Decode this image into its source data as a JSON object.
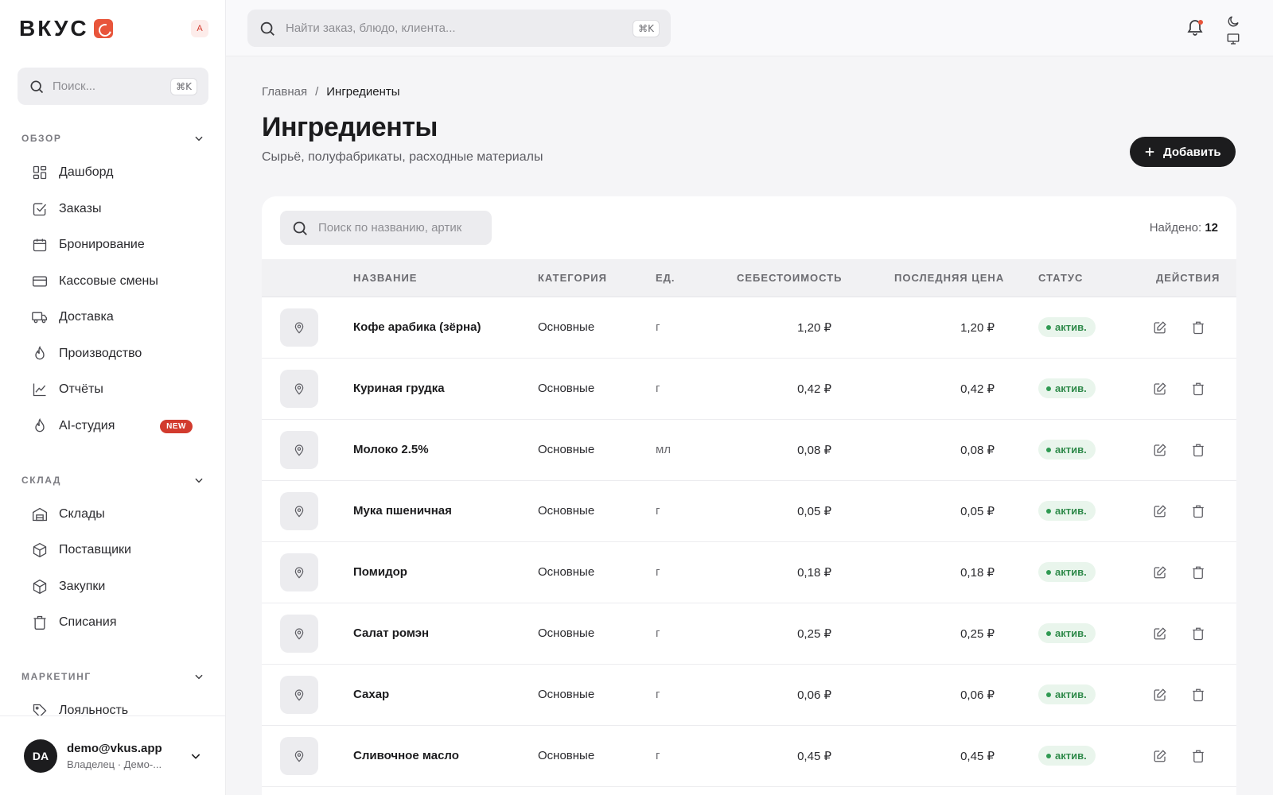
{
  "app": {
    "logo": "ВКУС",
    "avatar_letter": "A",
    "brand_color": "#e8553b"
  },
  "sidebar": {
    "search": {
      "placeholder": "Поиск...",
      "shortcut": "⌘K"
    },
    "sections": [
      {
        "label": "ОБЗОР",
        "items": [
          {
            "label": "Дашборд",
            "icon": "dashboard-icon"
          },
          {
            "label": "Заказы",
            "icon": "checkbox-icon"
          },
          {
            "label": "Бронирование",
            "icon": "calendar-icon"
          },
          {
            "label": "Кассовые смены",
            "icon": "credit-card-icon"
          },
          {
            "label": "Доставка",
            "icon": "truck-icon"
          },
          {
            "label": "Производство",
            "icon": "flame-icon"
          },
          {
            "label": "Отчёты",
            "icon": "chart-line-icon"
          },
          {
            "label": "AI-студия",
            "icon": "flame-icon",
            "badge": "NEW"
          }
        ]
      },
      {
        "label": "СКЛАД",
        "items": [
          {
            "label": "Склады",
            "icon": "warehouse-icon"
          },
          {
            "label": "Поставщики",
            "icon": "box-icon"
          },
          {
            "label": "Закупки",
            "icon": "box-icon"
          },
          {
            "label": "Списания",
            "icon": "trash-icon"
          }
        ]
      },
      {
        "label": "МАРКЕТИНГ",
        "items": [
          {
            "label": "Лояльность",
            "icon": "tag-icon"
          }
        ]
      }
    ],
    "user": {
      "initials": "DA",
      "email": "demo@vkus.app",
      "role": "Владелец · Демо-..."
    }
  },
  "topbar": {
    "search": {
      "placeholder": "Найти заказ, блюдо, клиента...",
      "shortcut": "⌘K"
    }
  },
  "page": {
    "breadcrumb": [
      "Главная",
      "Ингредиенты"
    ],
    "breadcrumb_sep": "/",
    "title": "Ингредиенты",
    "subtitle": "Сырьё, полуфабрикаты, расходные материалы",
    "add_button": "Добавить"
  },
  "table": {
    "search_placeholder": "Поиск по названию, артик",
    "found_label": "Найдено:",
    "found_count": "12",
    "columns": [
      "НАЗВАНИЕ",
      "КАТЕГОРИЯ",
      "ЕД.",
      "СЕБЕСТОИМОСТЬ",
      "ПОСЛЕДНЯЯ ЦЕНА",
      "СТАТУС",
      "ДЕЙСТВИЯ"
    ],
    "rows": [
      {
        "name": "Кофе арабика (зёрна)",
        "category": "Основные",
        "unit": "г",
        "cost": "1,20 ₽",
        "last_price": "1,20 ₽",
        "status": "актив."
      },
      {
        "name": "Куриная грудка",
        "category": "Основные",
        "unit": "г",
        "cost": "0,42 ₽",
        "last_price": "0,42 ₽",
        "status": "актив."
      },
      {
        "name": "Молоко 2.5%",
        "category": "Основные",
        "unit": "мл",
        "cost": "0,08 ₽",
        "last_price": "0,08 ₽",
        "status": "актив."
      },
      {
        "name": "Мука пшеничная",
        "category": "Основные",
        "unit": "г",
        "cost": "0,05 ₽",
        "last_price": "0,05 ₽",
        "status": "актив."
      },
      {
        "name": "Помидор",
        "category": "Основные",
        "unit": "г",
        "cost": "0,18 ₽",
        "last_price": "0,18 ₽",
        "status": "актив."
      },
      {
        "name": "Салат ромэн",
        "category": "Основные",
        "unit": "г",
        "cost": "0,25 ₽",
        "last_price": "0,25 ₽",
        "status": "актив."
      },
      {
        "name": "Сахар",
        "category": "Основные",
        "unit": "г",
        "cost": "0,06 ₽",
        "last_price": "0,06 ₽",
        "status": "актив."
      },
      {
        "name": "Сливочное масло",
        "category": "Основные",
        "unit": "г",
        "cost": "0,45 ₽",
        "last_price": "0,45 ₽",
        "status": "актив."
      }
    ]
  }
}
